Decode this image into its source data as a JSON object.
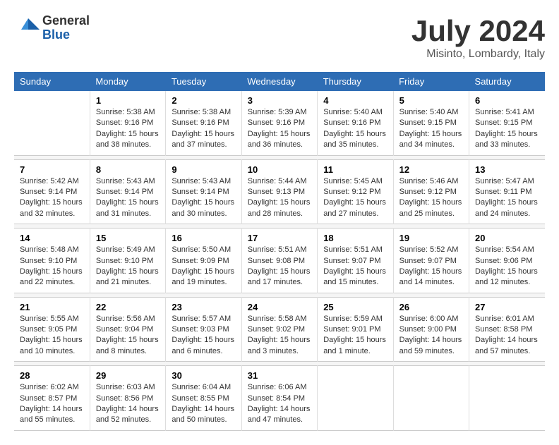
{
  "logo": {
    "general": "General",
    "blue": "Blue"
  },
  "title": "July 2024",
  "location": "Misinto, Lombardy, Italy",
  "weekdays": [
    "Sunday",
    "Monday",
    "Tuesday",
    "Wednesday",
    "Thursday",
    "Friday",
    "Saturday"
  ],
  "weeks": [
    [
      {
        "day": "",
        "info": ""
      },
      {
        "day": "1",
        "info": "Sunrise: 5:38 AM\nSunset: 9:16 PM\nDaylight: 15 hours\nand 38 minutes."
      },
      {
        "day": "2",
        "info": "Sunrise: 5:38 AM\nSunset: 9:16 PM\nDaylight: 15 hours\nand 37 minutes."
      },
      {
        "day": "3",
        "info": "Sunrise: 5:39 AM\nSunset: 9:16 PM\nDaylight: 15 hours\nand 36 minutes."
      },
      {
        "day": "4",
        "info": "Sunrise: 5:40 AM\nSunset: 9:16 PM\nDaylight: 15 hours\nand 35 minutes."
      },
      {
        "day": "5",
        "info": "Sunrise: 5:40 AM\nSunset: 9:15 PM\nDaylight: 15 hours\nand 34 minutes."
      },
      {
        "day": "6",
        "info": "Sunrise: 5:41 AM\nSunset: 9:15 PM\nDaylight: 15 hours\nand 33 minutes."
      }
    ],
    [
      {
        "day": "7",
        "info": "Sunrise: 5:42 AM\nSunset: 9:14 PM\nDaylight: 15 hours\nand 32 minutes."
      },
      {
        "day": "8",
        "info": "Sunrise: 5:43 AM\nSunset: 9:14 PM\nDaylight: 15 hours\nand 31 minutes."
      },
      {
        "day": "9",
        "info": "Sunrise: 5:43 AM\nSunset: 9:14 PM\nDaylight: 15 hours\nand 30 minutes."
      },
      {
        "day": "10",
        "info": "Sunrise: 5:44 AM\nSunset: 9:13 PM\nDaylight: 15 hours\nand 28 minutes."
      },
      {
        "day": "11",
        "info": "Sunrise: 5:45 AM\nSunset: 9:12 PM\nDaylight: 15 hours\nand 27 minutes."
      },
      {
        "day": "12",
        "info": "Sunrise: 5:46 AM\nSunset: 9:12 PM\nDaylight: 15 hours\nand 25 minutes."
      },
      {
        "day": "13",
        "info": "Sunrise: 5:47 AM\nSunset: 9:11 PM\nDaylight: 15 hours\nand 24 minutes."
      }
    ],
    [
      {
        "day": "14",
        "info": "Sunrise: 5:48 AM\nSunset: 9:10 PM\nDaylight: 15 hours\nand 22 minutes."
      },
      {
        "day": "15",
        "info": "Sunrise: 5:49 AM\nSunset: 9:10 PM\nDaylight: 15 hours\nand 21 minutes."
      },
      {
        "day": "16",
        "info": "Sunrise: 5:50 AM\nSunset: 9:09 PM\nDaylight: 15 hours\nand 19 minutes."
      },
      {
        "day": "17",
        "info": "Sunrise: 5:51 AM\nSunset: 9:08 PM\nDaylight: 15 hours\nand 17 minutes."
      },
      {
        "day": "18",
        "info": "Sunrise: 5:51 AM\nSunset: 9:07 PM\nDaylight: 15 hours\nand 15 minutes."
      },
      {
        "day": "19",
        "info": "Sunrise: 5:52 AM\nSunset: 9:07 PM\nDaylight: 15 hours\nand 14 minutes."
      },
      {
        "day": "20",
        "info": "Sunrise: 5:54 AM\nSunset: 9:06 PM\nDaylight: 15 hours\nand 12 minutes."
      }
    ],
    [
      {
        "day": "21",
        "info": "Sunrise: 5:55 AM\nSunset: 9:05 PM\nDaylight: 15 hours\nand 10 minutes."
      },
      {
        "day": "22",
        "info": "Sunrise: 5:56 AM\nSunset: 9:04 PM\nDaylight: 15 hours\nand 8 minutes."
      },
      {
        "day": "23",
        "info": "Sunrise: 5:57 AM\nSunset: 9:03 PM\nDaylight: 15 hours\nand 6 minutes."
      },
      {
        "day": "24",
        "info": "Sunrise: 5:58 AM\nSunset: 9:02 PM\nDaylight: 15 hours\nand 3 minutes."
      },
      {
        "day": "25",
        "info": "Sunrise: 5:59 AM\nSunset: 9:01 PM\nDaylight: 15 hours\nand 1 minute."
      },
      {
        "day": "26",
        "info": "Sunrise: 6:00 AM\nSunset: 9:00 PM\nDaylight: 14 hours\nand 59 minutes."
      },
      {
        "day": "27",
        "info": "Sunrise: 6:01 AM\nSunset: 8:58 PM\nDaylight: 14 hours\nand 57 minutes."
      }
    ],
    [
      {
        "day": "28",
        "info": "Sunrise: 6:02 AM\nSunset: 8:57 PM\nDaylight: 14 hours\nand 55 minutes."
      },
      {
        "day": "29",
        "info": "Sunrise: 6:03 AM\nSunset: 8:56 PM\nDaylight: 14 hours\nand 52 minutes."
      },
      {
        "day": "30",
        "info": "Sunrise: 6:04 AM\nSunset: 8:55 PM\nDaylight: 14 hours\nand 50 minutes."
      },
      {
        "day": "31",
        "info": "Sunrise: 6:06 AM\nSunset: 8:54 PM\nDaylight: 14 hours\nand 47 minutes."
      },
      {
        "day": "",
        "info": ""
      },
      {
        "day": "",
        "info": ""
      },
      {
        "day": "",
        "info": ""
      }
    ]
  ]
}
